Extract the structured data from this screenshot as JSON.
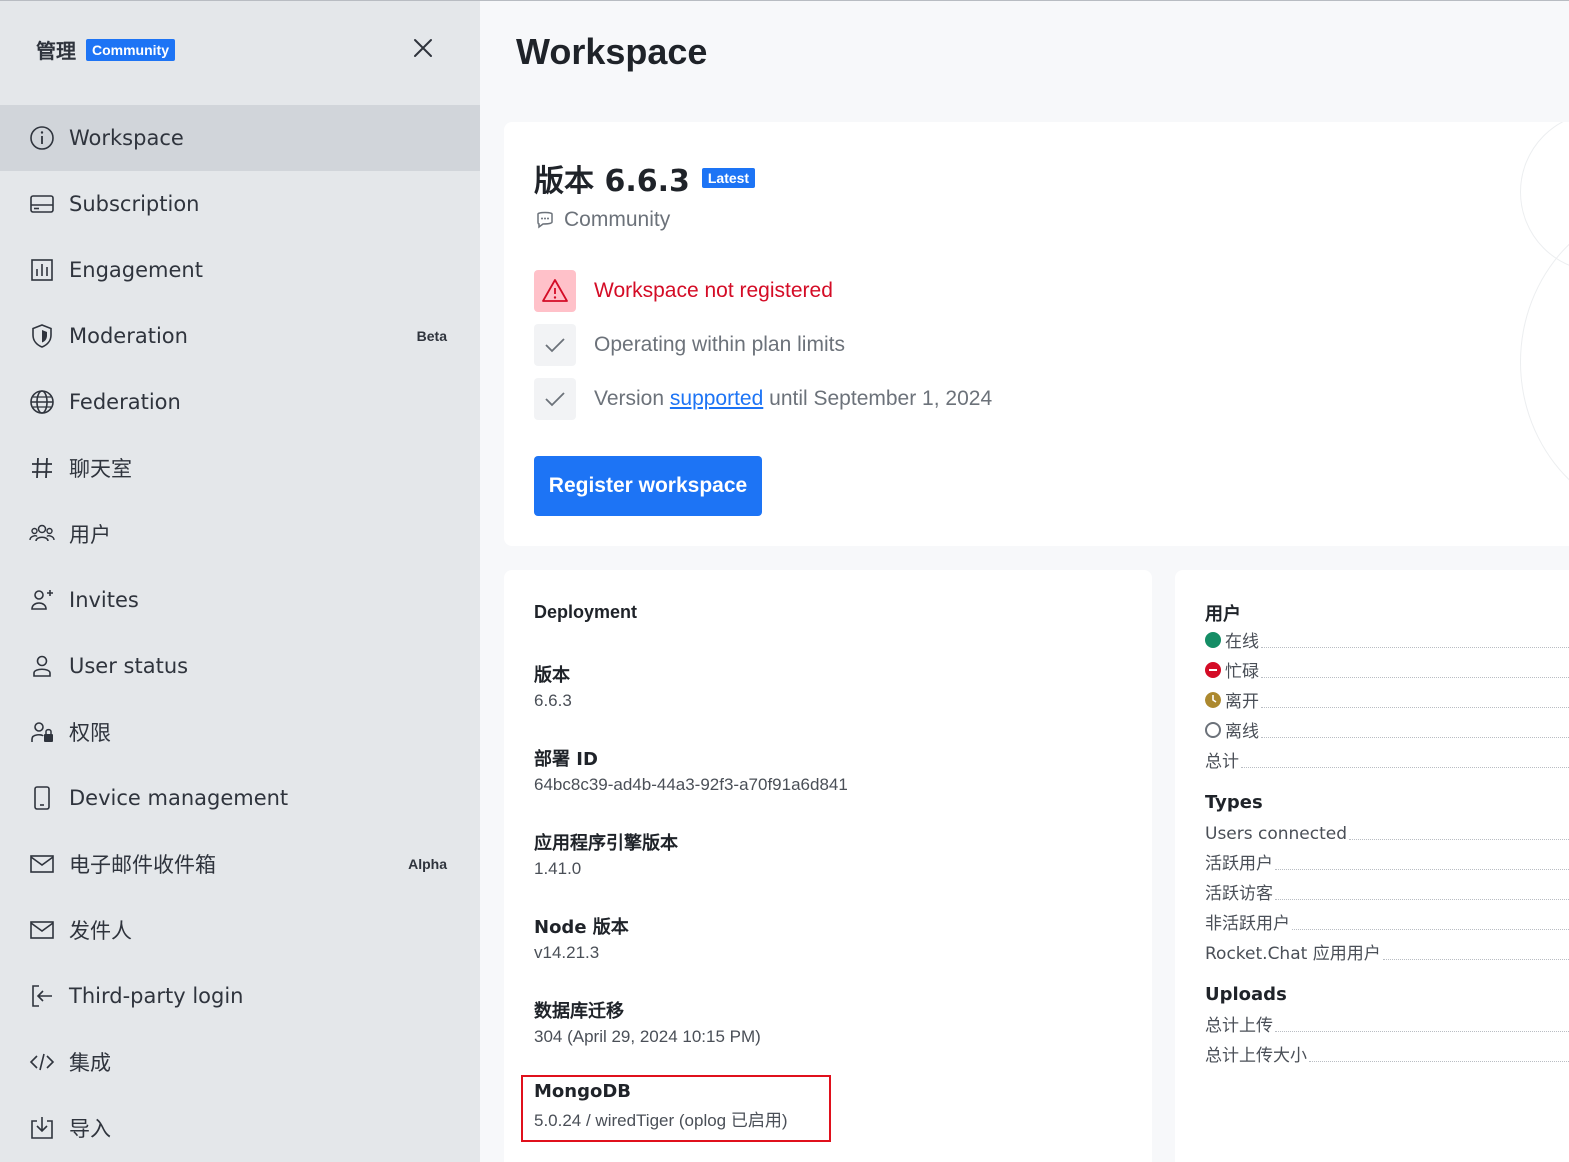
{
  "sidebar": {
    "title": "管理",
    "edition_badge": "Community",
    "items": [
      {
        "label": "Workspace",
        "icon": "info-icon",
        "active": true
      },
      {
        "label": "Subscription",
        "icon": "card-icon"
      },
      {
        "label": "Engagement",
        "icon": "bar-chart-icon"
      },
      {
        "label": "Moderation",
        "icon": "shield-icon",
        "tag": "Beta"
      },
      {
        "label": "Federation",
        "icon": "globe-icon"
      },
      {
        "label": "聊天室",
        "icon": "hash-icon"
      },
      {
        "label": "用户",
        "icon": "team-icon"
      },
      {
        "label": "Invites",
        "icon": "user-plus-icon"
      },
      {
        "label": "User status",
        "icon": "user-icon"
      },
      {
        "label": "权限",
        "icon": "user-lock-icon"
      },
      {
        "label": "Device management",
        "icon": "mobile-icon"
      },
      {
        "label": "电子邮件收件箱",
        "icon": "mail-icon",
        "tag": "Alpha"
      },
      {
        "label": "发件人",
        "icon": "mail-icon"
      },
      {
        "label": "Third-party login",
        "icon": "login-icon"
      },
      {
        "label": "集成",
        "icon": "code-icon"
      },
      {
        "label": "导入",
        "icon": "import-icon"
      }
    ]
  },
  "main": {
    "title": "Workspace",
    "version": {
      "title": "版本 6.6.3",
      "badge": "Latest",
      "edition": "Community",
      "status_warning": "Workspace not registered",
      "status_plan": "Operating within plan limits",
      "status_version_prefix": "Version",
      "status_version_link": "supported",
      "status_version_suffix": "until September 1, 2024",
      "register_button": "Register workspace"
    },
    "deployment": {
      "heading": "Deployment",
      "fields": [
        {
          "label": "版本",
          "value": "6.6.3"
        },
        {
          "label": "部署 ID",
          "value": "64bc8c39-ad4b-44a3-92f3-a70f91a6d841"
        },
        {
          "label": "应用程序引擎版本",
          "value": "1.41.0"
        },
        {
          "label": "Node 版本",
          "value": "v14.21.3"
        },
        {
          "label": "数据库迁移",
          "value": "304 (April 29, 2024 10:15 PM)"
        },
        {
          "label": "MongoDB",
          "value": "5.0.24 / wiredTiger (oplog 已启用)"
        }
      ]
    },
    "users": {
      "heading": "用户",
      "statuses": [
        {
          "label": "在线",
          "color": "#158d65"
        },
        {
          "label": "忙碌",
          "color": "#d40c26"
        },
        {
          "label": "离开",
          "color": "#ac892f"
        },
        {
          "label": "离线",
          "color": "#6c727a"
        }
      ],
      "total_label": "总计",
      "types_heading": "Types",
      "types": [
        "Users connected",
        "活跃用户",
        "活跃访客",
        "非活跃用户",
        "Rocket.Chat 应用用户"
      ],
      "uploads_heading": "Uploads",
      "uploads": [
        "总计上传",
        "总计上传大小"
      ]
    }
  },
  "colors": {
    "accent": "#1d74f5",
    "danger": "#d40c26",
    "highlight_border": "#e0101c"
  }
}
